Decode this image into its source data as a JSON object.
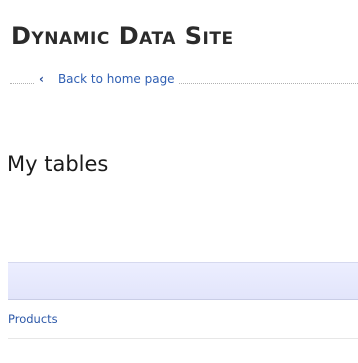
{
  "header": {
    "site_title": "Dynamic Data Site",
    "back_link_label": "Back to home page",
    "back_icon": "chevron-left-icon"
  },
  "main": {
    "heading": "My tables",
    "tables": [
      {
        "name": "Products"
      }
    ]
  },
  "colors": {
    "link": "#2f5fb3",
    "header_band": "#e5e8fc"
  }
}
